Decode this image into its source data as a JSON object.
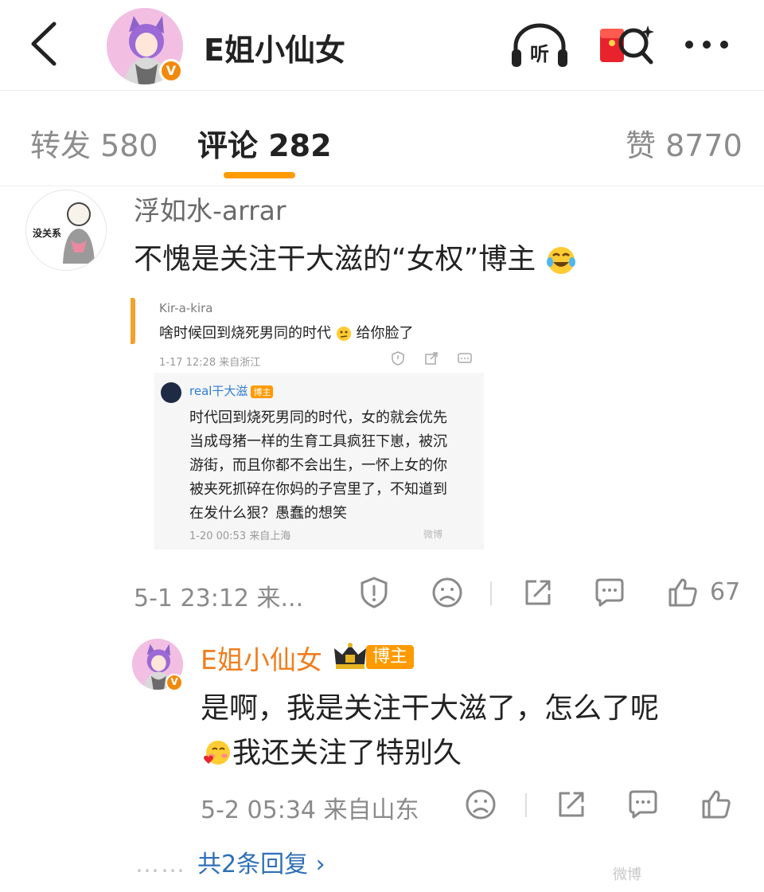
{
  "header": {
    "title": "E姐小仙女",
    "verified_badge": "V",
    "icons": [
      "back-icon",
      "listen-icon",
      "red-packet-search-icon",
      "more-icon"
    ],
    "listen_label": "听"
  },
  "tabs": [
    {
      "label": "转发 580",
      "active": false
    },
    {
      "label": "评论 282",
      "active": true
    },
    {
      "label": "赞 8770",
      "active": false
    }
  ],
  "accent_color": "#ff9a00",
  "comment": {
    "avatar_text": "没关系",
    "user": "浮如水-arrar",
    "text": "不愧是关注干大滋的“女权”博主",
    "emoji": "laughing-tears-emoji",
    "screenshot": {
      "user": "Kir-a-kira",
      "text": "啥时候回到烧死男同的时代",
      "text_after_emoji": "给你脸了",
      "meta": "1-17 12:28 来自浙江",
      "reply_user": "real干大滋",
      "reply_badge": "博主",
      "reply_lines": [
        "时代回到烧死男同的时代，女的就会优先",
        "当成母猪一样的生育工具疯狂下崽，被沉",
        "游街，而且你都不会出生，一怀上女的你",
        "被夹死抓碎在你妈的子宫里了，不知道到",
        "在发什么狠？愚蠢的想笑"
      ],
      "reply_meta": "1-20 00:53 来自上海",
      "watermark": "微博"
    },
    "time": "5-1 23:12 来...",
    "likes": "67"
  },
  "reply": {
    "user": "E姐小仙女",
    "badge": "博主",
    "lines": [
      "是啊，我是关注干大滋了，怎么了呢",
      "我还关注了特别久"
    ],
    "emoji": "blushing-heart-emoji",
    "time": "5-2 05:34 来自山东"
  },
  "more_replies": {
    "dots": "……",
    "label": "共2条回复 ›"
  },
  "watermark": "微博"
}
